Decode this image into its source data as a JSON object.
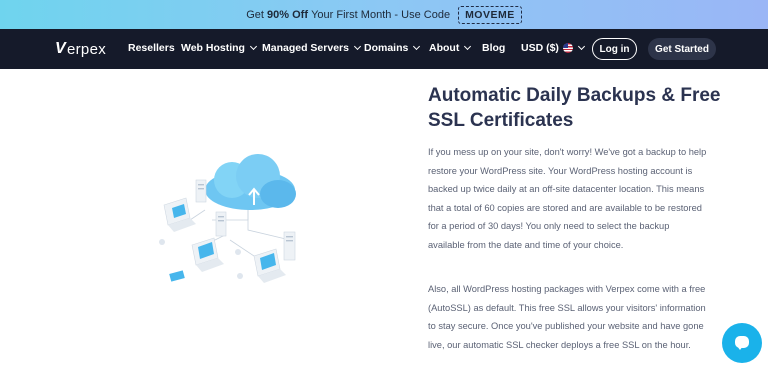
{
  "promo": {
    "prefix": "Get",
    "highlight": "90% Off",
    "suffix": "Your First Month - Use Code",
    "code": "MOVEME"
  },
  "nav": {
    "logo_mark": "V",
    "logo_text": "erpex",
    "items": [
      {
        "label": "Resellers"
      },
      {
        "label": "Web Hosting"
      },
      {
        "label": "Managed Servers"
      },
      {
        "label": "Domains"
      },
      {
        "label": "About"
      },
      {
        "label": "Blog"
      },
      {
        "label": "USD ($)"
      }
    ],
    "login_label": "Log in",
    "get_started_label": "Get Started"
  },
  "content": {
    "title": "Automatic Daily Backups & Free SSL Certificates",
    "paragraph1": "If you mess up on your site, don't worry! We've got a backup to help restore your WordPress site. Your WordPress hosting account is backed up twice daily at an off-site datacenter location. This means that a total of 60 copies are stored and are available to be restored for a period of 30 days! You only need to select the backup available from the date and time of your choice.",
    "paragraph2": "Also, all WordPress hosting packages with Verpex come with a free (AutoSSL) as default. This free SSL allows your visitors' information to stay secure. Once you've published your website and have gone live, our automatic SSL checker deploys a free SSL on the hour."
  },
  "colors": {
    "nav_bg": "#151a2a",
    "heading": "#2b3350",
    "chat_button": "#1ab2ea"
  },
  "icons": [
    "chevron-down-icon",
    "us-flag-icon",
    "cloud-backup-illustration",
    "chat-icon"
  ]
}
